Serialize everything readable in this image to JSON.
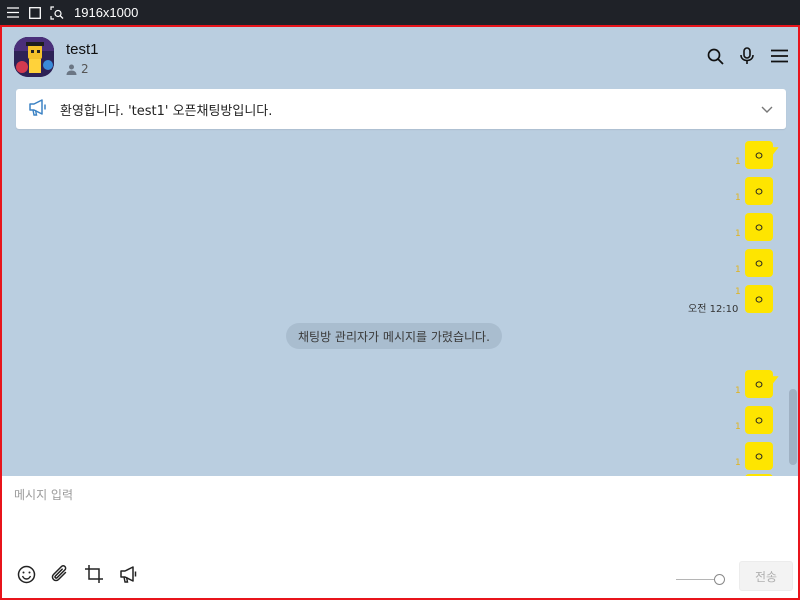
{
  "sysbar": {
    "resolution": "1916x1000",
    "icons": [
      "menu-icon",
      "square-icon",
      "screenshot-icon"
    ]
  },
  "header": {
    "title": "test1",
    "member_count": "2",
    "icons": [
      "search-icon",
      "microphone-icon",
      "hamburger-menu-icon"
    ]
  },
  "notice": {
    "text": "환영합니다. 'test1' 오픈채팅방입니다."
  },
  "messages": {
    "bubble_text": "ㅇ",
    "unread_mark": "1",
    "time": "오전 12:10",
    "system_message": "채팅방 관리자가 메시지를 가렸습니다."
  },
  "input": {
    "placeholder": "메시지 입력",
    "value": "",
    "send_label": "전송"
  },
  "tools": [
    "emoticon-icon",
    "attach-icon",
    "crop-icon",
    "announce-icon"
  ],
  "colors": {
    "chat_bg": "#bacee0",
    "bubble": "#fee500",
    "border": "#e8141b"
  }
}
